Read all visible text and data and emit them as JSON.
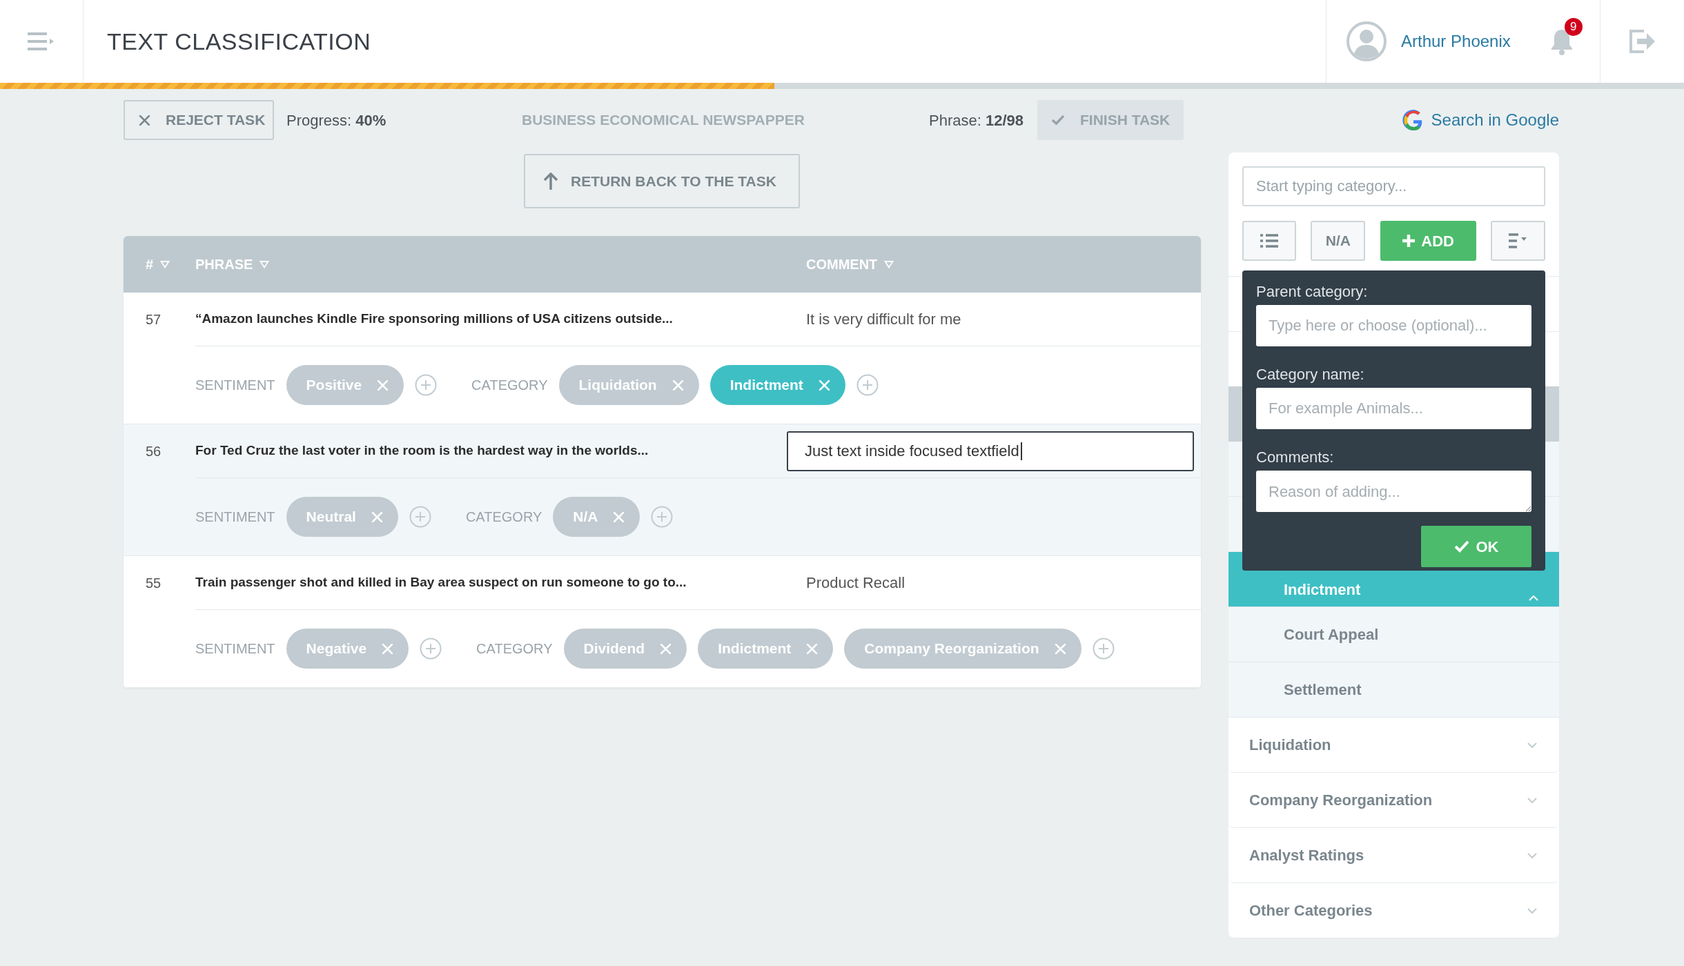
{
  "header": {
    "title": "TEXT CLASSIFICATION",
    "user_name": "Arthur Phoenix",
    "notification_count": "9"
  },
  "progress_bar": {
    "level": 0.46
  },
  "toolbar": {
    "reject_button": "REJECT TASK",
    "progress": "Progress: **40%**",
    "source": "BUSINESS ECONOMICAL NEWSPAPPER",
    "phrase_counter": "Phrase: **12/98**",
    "finish_button": {
      "label": "FINISH TASK",
      "disabled": true
    },
    "google_link": "Search in Google",
    "return_button": "RETURN BACK TO THE TASK"
  },
  "table": {
    "columns": [
      "#",
      "PHRASE",
      "COMMENT"
    ],
    "rows": [
      {
        "number": "57",
        "phrase": "“Amazon launches Kindle Fire sponsoring millions of USA citizens outside...",
        "comment": "It is very difficult for me",
        "editing": false,
        "selected": false,
        "sentiment_label": "SENTIMENT",
        "sentiment": [
          {
            "label": "Positive",
            "selected": false
          }
        ],
        "category_label": "CATEGORY",
        "categories": [
          {
            "label": "Liquidation",
            "selected": false
          },
          {
            "label": "Indictment",
            "selected": true
          }
        ]
      },
      {
        "number": "56",
        "phrase": "For Ted Cruz  the last voter in the room is the hardest way in the worlds...",
        "comment": "Just text inside focused textfield",
        "editing": true,
        "selected": true,
        "sentiment_label": "SENTIMENT",
        "sentiment": [
          {
            "label": "Neutral",
            "selected": false
          }
        ],
        "category_label": "CATEGORY",
        "categories": [
          {
            "label": "N/A",
            "selected": false
          }
        ]
      },
      {
        "number": "55",
        "phrase": "Train passenger shot and killed in Bay area  suspect on run someone to go to...",
        "comment": "Product Recall",
        "editing": false,
        "selected": false,
        "sentiment_label": "SENTIMENT",
        "sentiment": [
          {
            "label": "Negative",
            "selected": false
          }
        ],
        "category_label": "CATEGORY",
        "categories": [
          {
            "label": "Dividend",
            "selected": false
          },
          {
            "label": "Indictment",
            "selected": false
          },
          {
            "label": "Company Reorganization",
            "selected": false
          }
        ]
      }
    ]
  },
  "side_panel": {
    "search_placeholder": "Start typing category...",
    "na_button": "N/A",
    "add_button": "ADD",
    "subcategories": [
      {
        "label": "Indictment",
        "selected": true
      },
      {
        "label": "Court Appeal",
        "selected": false
      },
      {
        "label": "Settlement",
        "selected": false
      }
    ],
    "categories": [
      {
        "label": "Liquidation",
        "expanded": false
      },
      {
        "label": "Company Reorganization",
        "expanded": false
      },
      {
        "label": "Analyst Ratings",
        "expanded": false
      },
      {
        "label": "Other Categories",
        "expanded": false
      }
    ]
  },
  "add_popup": {
    "fields": [
      {
        "label": "Parent category:",
        "placeholder": "Type here or choose (optional)...",
        "kind": "input"
      },
      {
        "label": "Category name:",
        "placeholder": "For example Animals...",
        "kind": "input"
      },
      {
        "label": "Comments:",
        "placeholder": "Reason of adding...",
        "kind": "textarea"
      }
    ],
    "ok_button": "OK"
  }
}
